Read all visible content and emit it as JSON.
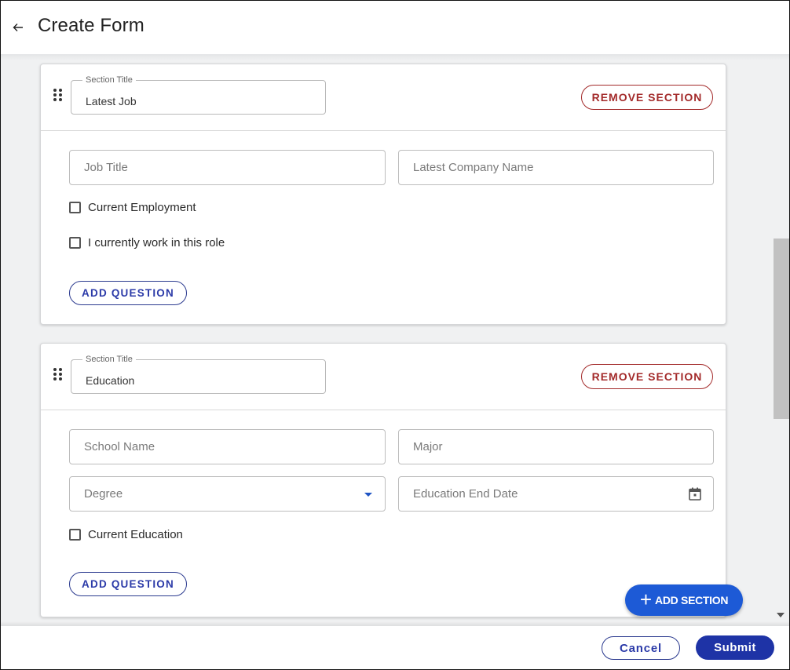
{
  "header": {
    "back_icon": "arrow-left-icon",
    "title": "Create Form"
  },
  "sections": [
    {
      "title_label": "Section Title",
      "title_value": "Latest Job",
      "remove_label": "REMOVE SECTION",
      "fields": [
        {
          "placeholder": "Job Title",
          "value": ""
        },
        {
          "placeholder": "Latest Company Name",
          "value": ""
        }
      ],
      "checkboxes": [
        {
          "label": "Current Employment",
          "checked": false
        },
        {
          "label": "I currently work in this role",
          "checked": false
        }
      ],
      "add_question_label": "ADD QUESTION"
    },
    {
      "title_label": "Section Title",
      "title_value": "Education",
      "remove_label": "REMOVE SECTION",
      "fields": [
        {
          "placeholder": "School Name",
          "value": ""
        },
        {
          "placeholder": "Major",
          "value": ""
        }
      ],
      "select": {
        "placeholder": "Degree",
        "icon": "caret-down-icon"
      },
      "date": {
        "placeholder": "Education End Date",
        "icon": "calendar-icon"
      },
      "checkboxes": [
        {
          "label": "Current Education",
          "checked": false
        }
      ],
      "add_question_label": "ADD QUESTION"
    }
  ],
  "fab": {
    "icon": "plus-icon",
    "label": "ADD SECTION"
  },
  "footer": {
    "cancel_label": "Cancel",
    "submit_label": "Submit"
  },
  "colors": {
    "primary": "#1e33a6",
    "fab": "#1d5ad6",
    "danger": "#a32a2a",
    "background": "#f0f1f2"
  }
}
